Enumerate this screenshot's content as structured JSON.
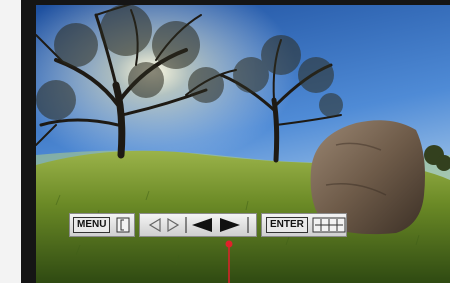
{
  "toolbar": {
    "menu_label": "MENU",
    "enter_label": "ENTER"
  },
  "icons": {
    "menu_exit": "bracket-icon",
    "prev_outline": "triangle-left-outline-icon",
    "next_outline": "triangle-right-outline-icon",
    "prev_filled": "triangle-left-filled-icon",
    "next_filled": "triangle-right-filled-icon",
    "enter_grid": "grid-icon"
  },
  "colors": {
    "sky": "#3a78c8",
    "grass": "#6f8f2a",
    "marker": "#e0202a"
  }
}
